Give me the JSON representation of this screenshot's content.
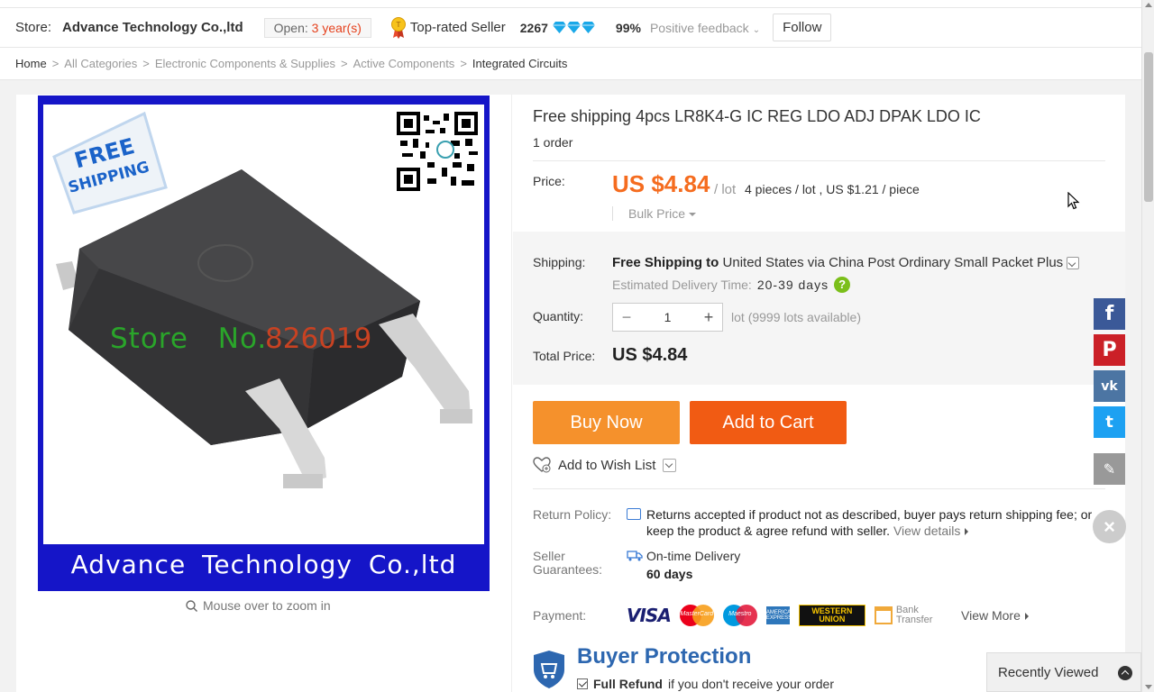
{
  "store_bar": {
    "store_label": "Store:",
    "store_name": "Advance Technology Co.,ltd",
    "open_prefix": "Open:",
    "open_years": "3 year(s)",
    "top_rated": "Top-rated Seller",
    "score": "2267",
    "feedback_pct": "99%",
    "feedback_label": "Positive feedback",
    "follow": "Follow"
  },
  "breadcrumb": [
    "Home",
    "All Categories",
    "Electronic Components & Supplies",
    "Active Components",
    "Integrated Circuits"
  ],
  "gallery": {
    "badge_line1": "FREE",
    "badge_line2": "SHIPPING",
    "watermark": "Store No.",
    "watermark_num": "826019",
    "footer_text": "Advance Technology Co.,ltd",
    "zoom_hint": "Mouse over to zoom in"
  },
  "product": {
    "title": "Free shipping 4pcs LR8K4-G IC REG LDO ADJ DPAK LDO IC",
    "orders": "1 order",
    "price_label": "Price:",
    "price": "US $4.84",
    "price_unit": "/ lot",
    "price_per": "4 pieces / lot , US $1.21 / piece",
    "bulk_price": "Bulk Price",
    "shipping_label": "Shipping:",
    "shipping_free": "Free Shipping to",
    "shipping_via": "United States via China Post Ordinary Small Packet Plus",
    "edt_label": "Estimated Delivery Time:",
    "edt_days": "20-39 days",
    "qty_label": "Quantity:",
    "qty_value": "1",
    "qty_unit": "lot",
    "qty_avail": "(9999 lots available)",
    "total_label": "Total Price:",
    "total_value": "US $4.84",
    "buy_now": "Buy Now",
    "add_to_cart": "Add to Cart",
    "wish": "Add to Wish List",
    "return_label": "Return Policy:",
    "return_text": "Returns accepted if product not as described, buyer pays return shipping fee; or keep the product & agree refund with seller.",
    "view_details": "View details",
    "guarantee_label_1": "Seller",
    "guarantee_label_2": "Guarantees:",
    "guarantee_1": "On-time Delivery",
    "guarantee_2": "60 days",
    "payment_label": "Payment:",
    "visa": "VISA",
    "mastercard": "MasterCard",
    "maestro": "Maestro",
    "amex": "AMERICAN EXPRESS",
    "wu1": "WESTERN",
    "wu2": "UNION",
    "bank1": "Bank",
    "bank2": "Transfer",
    "view_more": "View More",
    "bp_title": "Buyer Protection",
    "bp_strong": "Full Refund",
    "bp_rest": "if you don't receive your order"
  },
  "social": {
    "fb": "f",
    "pin": "P",
    "vk": "vk",
    "tw": "t",
    "edit": "✎"
  },
  "recently_viewed": "Recently Viewed",
  "colors": {
    "price": "#f56c1f",
    "buy": "#f5912c",
    "cart": "#f15b13",
    "frame": "#1515c8"
  }
}
